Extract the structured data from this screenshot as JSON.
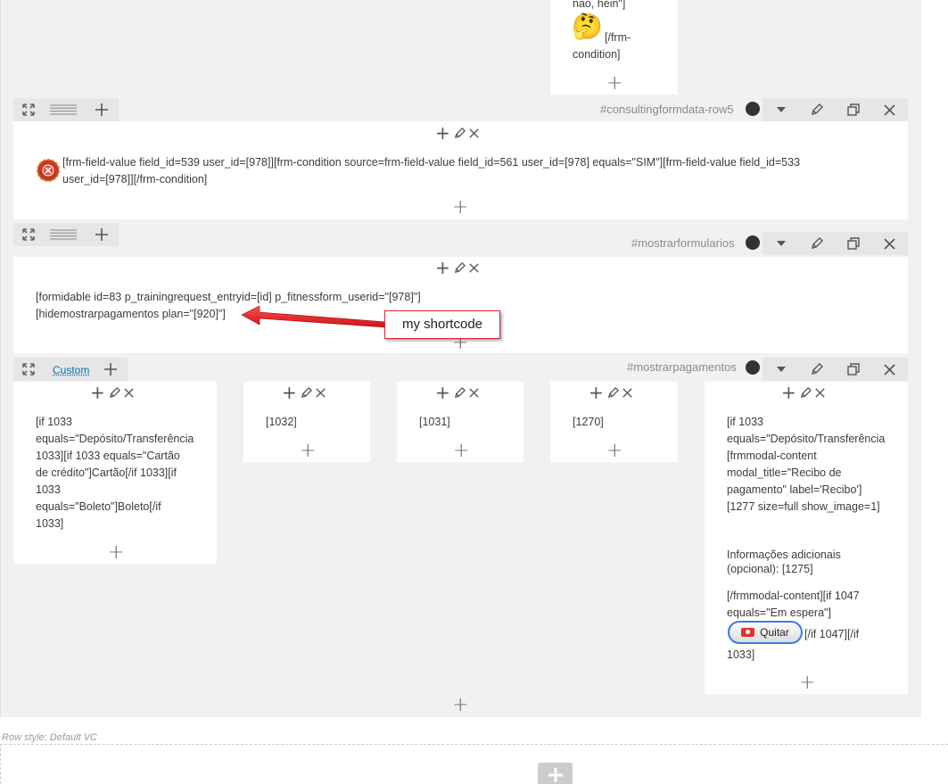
{
  "top_fragment": {
    "line1": "nao, hein\"]",
    "emoji": "🤔",
    "after_emoji": "[/frm-",
    "line3": "condition]"
  },
  "rows": [
    {
      "id_label": "#consultingformdata-row5",
      "content_line1": "[frm-field-value field_id=539 user_id=[978]][frm-condition source=frm-field-value field_id=561 user_id=[978] equals=\"SIM\"][frm-field-value field_id=533",
      "content_line2": "user_id=[978]][/frm-condition]"
    },
    {
      "id_label": "#mostrarformularios",
      "content_line1": "[formidable id=83 p_trainingrequest_entryid=[id] p_fitnessform_userid=\"[978]\"]",
      "content_line2": "[hidemostrarpagamentos plan=\"[920]\"]",
      "callout": "my shortcode"
    },
    {
      "id_label": "#mostrarpagamentos",
      "custom_label": "Custom",
      "columns": [
        {
          "lines": [
            "[if 1033",
            "equals=\"Depósito/Transferência",
            "1033][if 1033 equals=\"Cartão",
            "de crédito\"]Cartão[/if 1033][if",
            "1033",
            "equals=\"Boleto\"]Boleto[/if",
            "1033]"
          ]
        },
        {
          "lines": [
            "[1032]"
          ]
        },
        {
          "lines": [
            "[1031]"
          ]
        },
        {
          "lines": [
            "[1270]"
          ]
        },
        {
          "lines_a": [
            "[if 1033",
            "equals=\"Depósito/Transferência",
            "[frmmodal-content",
            "modal_title=\"Recibo de",
            "pagamento\" label='Recibo']",
            "[1277 size=full show_image=1]"
          ],
          "lines_b": [
            "Informações adicionais",
            "(opcional): [1275]"
          ],
          "lines_c": [
            "[/frmmodal-content][if 1047",
            "equals=\"Em espera\"]"
          ],
          "button_label": "Quitar",
          "after_button": "[/if 1047][/if",
          "last_line": "1033]"
        }
      ]
    }
  ],
  "row_style": "Row style: Default VC",
  "icons": {
    "expand": "expand-icon",
    "drag": "drag-handle-icon",
    "add": "plus-icon",
    "toggle": "chevron-down-icon",
    "edit": "pencil-icon",
    "clone": "clone-icon",
    "delete": "close-icon"
  },
  "colors": {
    "accent_blue": "#0073aa",
    "callout_red": "#d9262c"
  }
}
